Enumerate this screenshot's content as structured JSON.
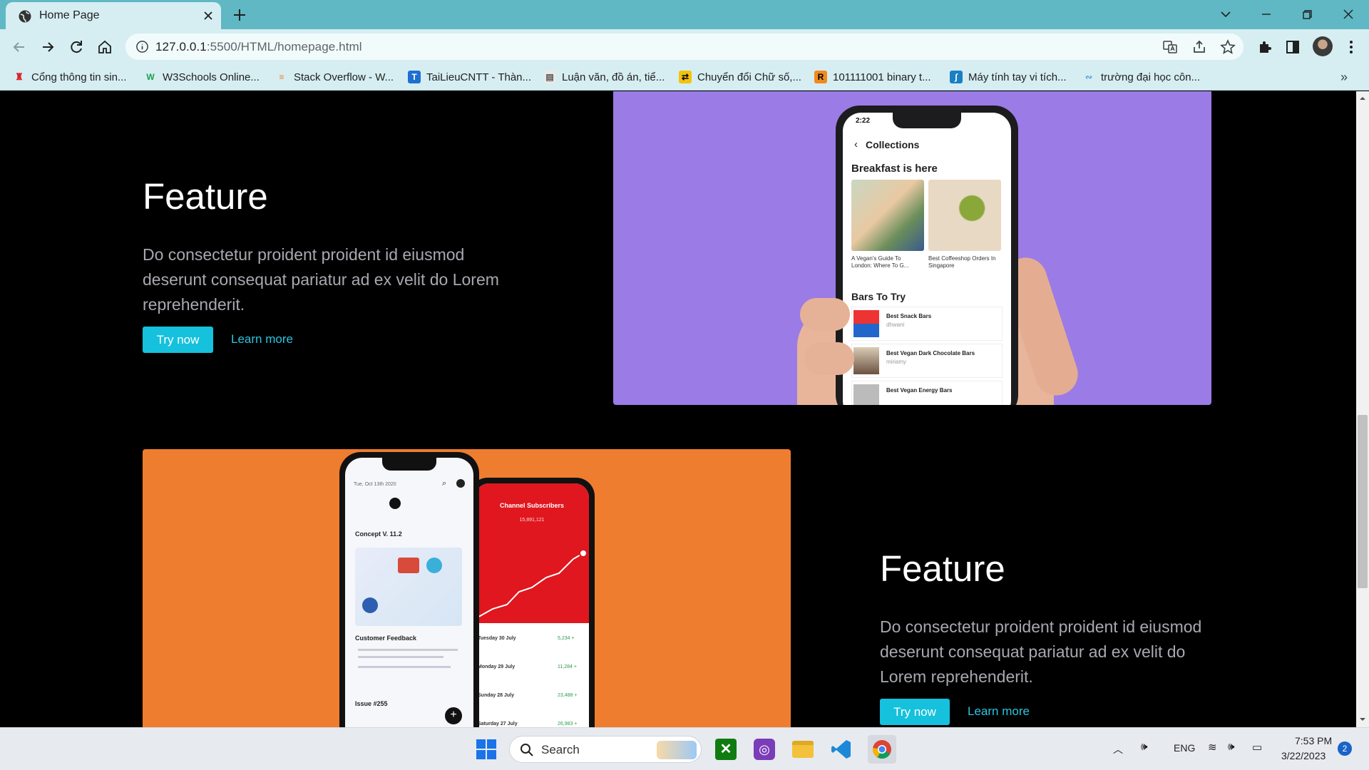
{
  "browser": {
    "tab_title": "Home Page",
    "url_host": "127.0.0.1",
    "url_rest": ":5500/HTML/homepage.html",
    "bookmarks": [
      {
        "label": "Cổng thông tin sin...",
        "icon": "university-icon"
      },
      {
        "label": "W3Schools Online...",
        "icon": "w3schools-icon"
      },
      {
        "label": "Stack Overflow - W...",
        "icon": "stackoverflow-icon"
      },
      {
        "label": "TaiLieuCNTT - Thàn...",
        "icon": "tailieu-icon"
      },
      {
        "label": "Luận văn, đồ án, tiể...",
        "icon": "document-icon"
      },
      {
        "label": "Chuyển đổi Chữ số,...",
        "icon": "convert-icon"
      },
      {
        "label": "101111001 binary t...",
        "icon": "r-icon"
      },
      {
        "label": "Máy tính tay vi tích...",
        "icon": "calculator-icon"
      },
      {
        "label": "trường đại học côn...",
        "icon": "link-icon"
      }
    ]
  },
  "page": {
    "feature1": {
      "title": "Feature",
      "text": "Do consectetur proident proident id eiusmod deserunt consequat pariatur ad ex velit do Lorem reprehenderit.",
      "try_label": "Try now",
      "learn_label": "Learn more"
    },
    "feature2": {
      "title": "Feature",
      "text": "Do consectetur proident proident id eiusmod deserunt consequat pariatur ad ex velit do Lorem reprehenderit.",
      "try_label": "Try now",
      "learn_label": "Learn more"
    },
    "phone1": {
      "time": "2:22",
      "header": "Collections",
      "section1": "Breakfast is here",
      "card1": "A Vegan's Guide To London: Where To G...",
      "card2": "Best Coffeeshop Orders In Singapore",
      "section2": "Bars To Try",
      "row1": "Best Snack Bars",
      "row1_user": "dhwani",
      "row2": "Best Vegan Dark Chocolate Bars",
      "row2_user": "miriamy",
      "row3": "Best Vegan Energy Bars"
    },
    "phone2": {
      "date": "Tue, Oct 13th 2020",
      "concept": "Concept V. 11.2",
      "feedback": "Customer Feedback",
      "issue": "Issue #255",
      "channel": "Channel Subscribers",
      "subs": "15,891,121",
      "rows": [
        "Tuesday 30 July",
        "Monday 29 July",
        "Sunday 28 July",
        "Saturday 27 July"
      ],
      "values": [
        "5,234 +",
        "11,284 +",
        "23,488 +",
        "26,983 +"
      ]
    },
    "colors": {
      "purple_panel": "#9b7be6",
      "orange_panel": "#ee7d2f",
      "accent": "#15c1dc"
    }
  },
  "taskbar": {
    "search_label": "Search",
    "lang": "ENG",
    "time": "7:53 PM",
    "date": "3/22/2023",
    "notifications": "2"
  }
}
